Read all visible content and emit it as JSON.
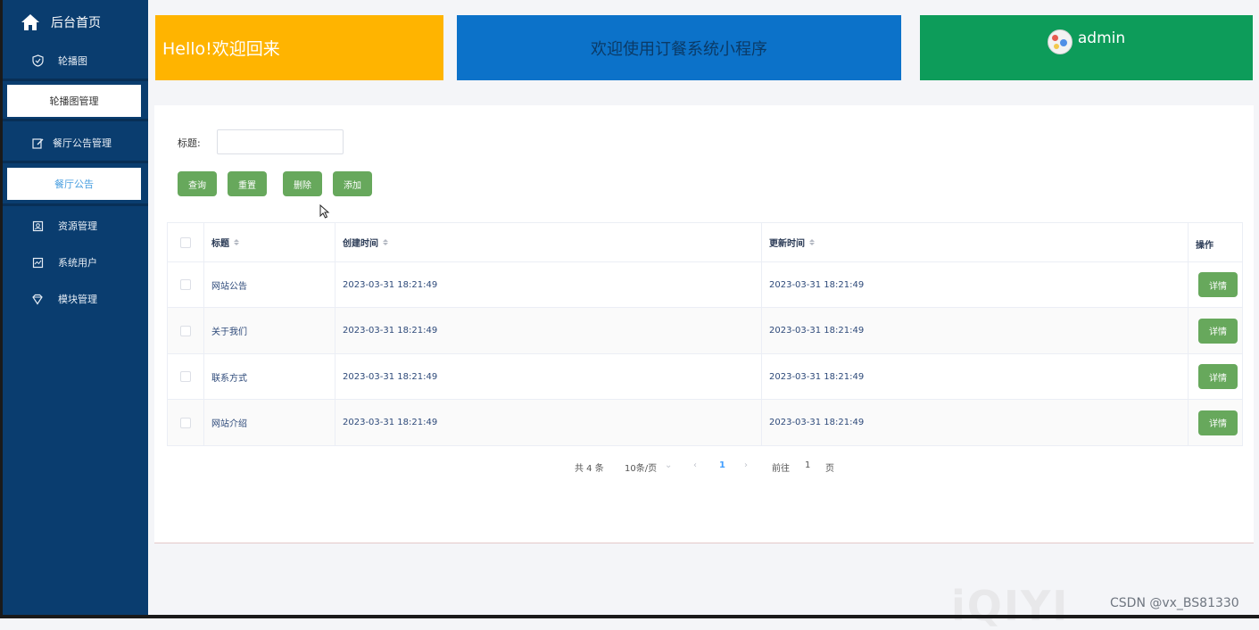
{
  "sidebar": {
    "home": "后台首页",
    "group_carousel": "轮播图",
    "carousel_manage": "轮播图管理",
    "group_notice": "餐厅公告管理",
    "notice": "餐厅公告",
    "resource": "资源管理",
    "system_user": "系统用户",
    "module": "模块管理"
  },
  "banner": {
    "hello": "Hello!欢迎回来",
    "welcome": "欢迎使用订餐系统小程序",
    "user": "admin"
  },
  "search": {
    "label": "标题:",
    "placeholder": ""
  },
  "toolbar": {
    "query": "查询",
    "reset": "重置",
    "delete": "删除",
    "add": "添加"
  },
  "table": {
    "columns": [
      "标题",
      "创建时间",
      "更新时间",
      "操作"
    ],
    "rows": [
      {
        "title": "网站公告",
        "created": "2023-03-31 18:21:49",
        "updated": "2023-03-31 18:21:49",
        "action": "详情"
      },
      {
        "title": "关于我们",
        "created": "2023-03-31 18:21:49",
        "updated": "2023-03-31 18:21:49",
        "action": "详情"
      },
      {
        "title": "联系方式",
        "created": "2023-03-31 18:21:49",
        "updated": "2023-03-31 18:21:49",
        "action": "详情"
      },
      {
        "title": "网站介绍",
        "created": "2023-03-31 18:21:49",
        "updated": "2023-03-31 18:21:49",
        "action": "详情"
      }
    ]
  },
  "pagination": {
    "total": "共 4 条",
    "page_size": "10条/页",
    "current": "1",
    "goto_label": "前往",
    "goto_value": "1",
    "page_unit": "页"
  },
  "watermark": "CSDN @vx_BS81330",
  "overlay_logo": "iQIYI",
  "colors": {
    "sidebar": "#0a3d6f",
    "yellow": "#ffb400",
    "blue": "#0c72c9",
    "green": "#0d9c5a",
    "button": "#67a85c"
  }
}
